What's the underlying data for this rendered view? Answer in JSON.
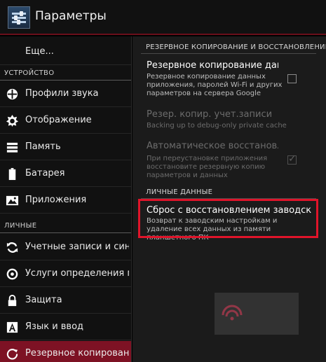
{
  "app": {
    "title": "Параметры",
    "icon": "settings-sliders-icon"
  },
  "sidebar": {
    "more_label": "Еще...",
    "section_device": "УСТРОЙСТВО",
    "section_personal": "ЛИЧНЫЕ",
    "items": [
      {
        "label": "Профили звука",
        "icon": "sound-profile-icon"
      },
      {
        "label": "Отображение",
        "icon": "display-icon"
      },
      {
        "label": "Память",
        "icon": "storage-icon"
      },
      {
        "label": "Батарея",
        "icon": "battery-icon"
      },
      {
        "label": "Приложения",
        "icon": "apps-icon"
      },
      {
        "label": "Учетные записи и синхр",
        "icon": "sync-icon"
      },
      {
        "label": "Услуги определения ме",
        "icon": "location-icon"
      },
      {
        "label": "Защита",
        "icon": "lock-icon"
      },
      {
        "label": "Язык и ввод",
        "icon": "language-icon"
      },
      {
        "label": "Резервное копирование",
        "icon": "backup-icon",
        "active": true
      }
    ]
  },
  "content": {
    "section_backup": "РЕЗЕРВНОЕ КОПИРОВАНИЕ И ВОССТАНОВЛЕНИЕ",
    "section_personal": "ЛИЧНЫЕ ДАННЫЕ",
    "prefs": {
      "backup": {
        "title": "Резервное копирование данны",
        "summary": "Резервное копирование данных приложения, паролей Wi-Fi и других параметров на сервера Google",
        "checked": false
      },
      "backup_account": {
        "title": "Резер. копир. учет.записи",
        "summary": "Backing up to debug-only private cache"
      },
      "auto_restore": {
        "title": "Автоматическое восстановле",
        "summary": "При переустановке приложения восстановите резервную копию параметров и данных",
        "checked": true
      },
      "factory_reset": {
        "title": "Сброс с восстановлением заводских н",
        "summary": "Возврат к заводским настройкам и удаление всех данных из памяти планшетного ПК"
      }
    },
    "highlight_color": "#e0142a"
  },
  "colors": {
    "active_item": "#7d1224",
    "actionbar_border": "#6a0f1a"
  }
}
